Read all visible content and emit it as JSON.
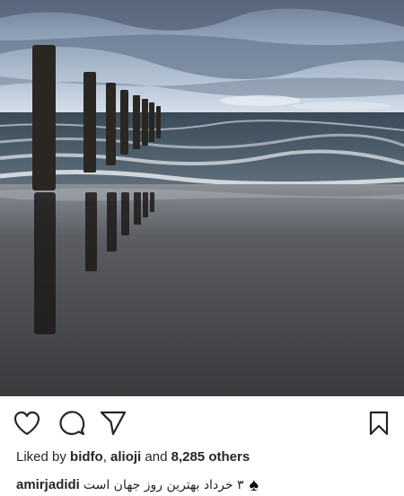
{
  "post": {
    "likes": {
      "prefix": "Liked by",
      "user1": "bidfo",
      "separator": ",",
      "user2": "alioji",
      "conjunction": "and",
      "others": "8,285 others"
    },
    "caption": {
      "username": "amirjadidi",
      "text": "۳ خرداد بهترین روز جهان است",
      "emoji_icon": "spade-icon"
    }
  },
  "actions": {
    "like_icon": "heart-icon",
    "comment_icon": "comment-icon",
    "share_icon": "paper-plane-icon",
    "save_icon": "bookmark-icon"
  },
  "colors": {
    "text": "#262626",
    "icon": "#262626"
  }
}
